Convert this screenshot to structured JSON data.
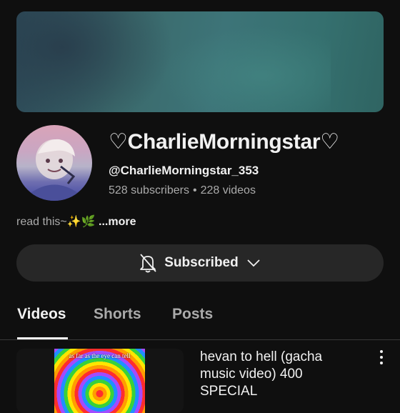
{
  "channel": {
    "name": "♡CharlieMorningstar♡",
    "handle": "@CharlieMorningstar_353",
    "subscribers": "528 subscribers",
    "separator": "•",
    "videos": "228 videos",
    "description": "read this~✨🌿",
    "more_label": "...more"
  },
  "subscribe_button": {
    "label": "Subscribed",
    "icon": "bell-off-icon",
    "dropdown_icon": "chevron-down-icon"
  },
  "tabs": [
    {
      "label": "Videos",
      "active": true
    },
    {
      "label": "Shorts",
      "active": false
    },
    {
      "label": "Posts",
      "active": false
    }
  ],
  "videos": [
    {
      "title": "hevan to hell (gacha music video) 400 SPECIAL",
      "thumbnail_caption": "as far as the eye can tell"
    }
  ],
  "colors": {
    "background": "#0f0f0f",
    "button_bg": "#272727",
    "text_primary": "#f1f1f1",
    "text_secondary": "#aaaaaa"
  }
}
